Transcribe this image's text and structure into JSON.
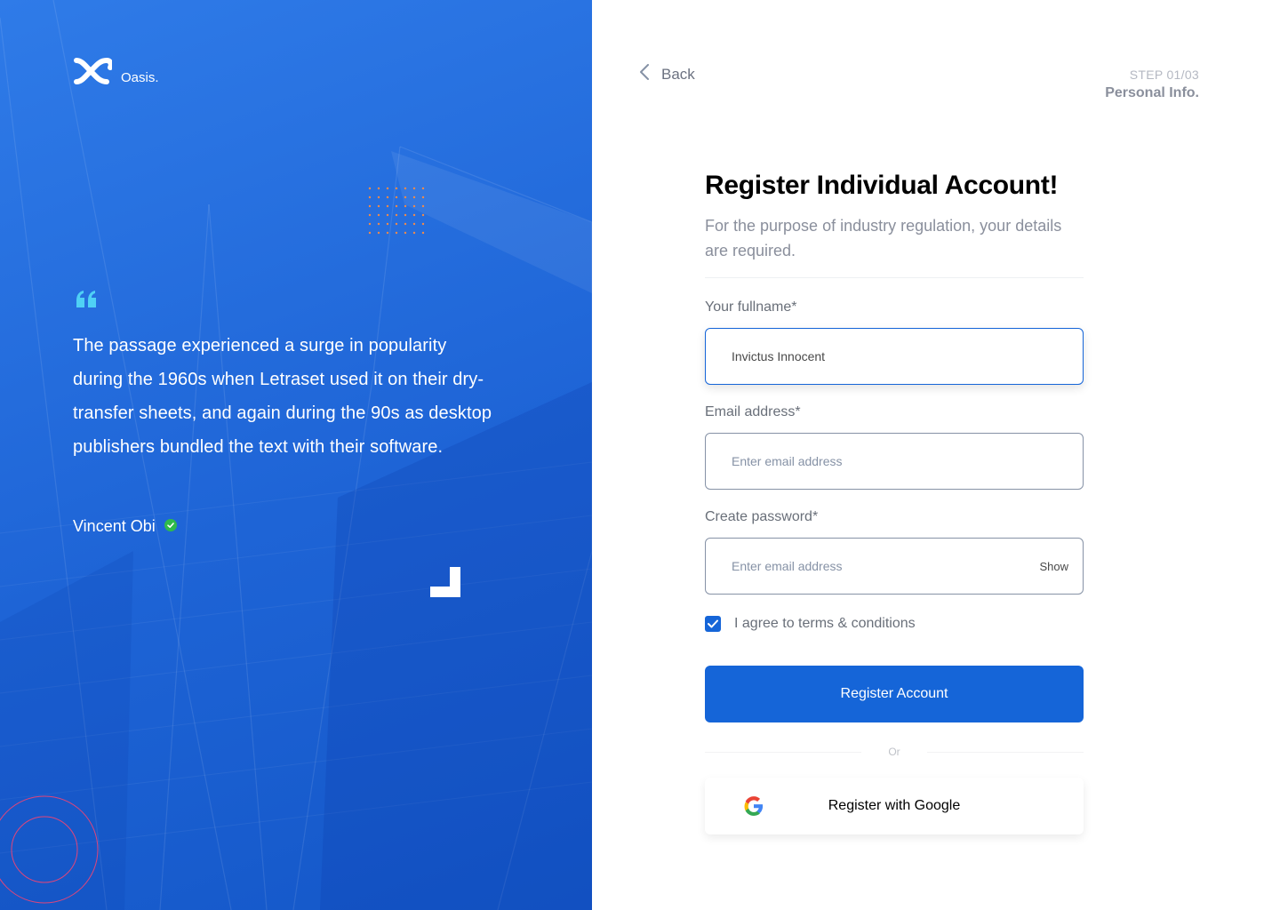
{
  "brand": {
    "name": "Oasis.",
    "logo_icon": "oasis-logo-icon"
  },
  "testimonial": {
    "text": "The passage experienced a surge in popularity during the 1960s when Letraset used it on their dry-transfer sheets, and again during the 90s as desktop publishers bundled the text with their software.",
    "author": "Vincent Obi",
    "verified_icon": "check-circle-icon"
  },
  "nav": {
    "back_label": "Back",
    "back_icon": "chevron-left-icon"
  },
  "step": {
    "number": "STEP 01/03",
    "name": "Personal Info."
  },
  "form": {
    "title": "Register Individual Account!",
    "subtitle": "For the purpose of industry regulation, your details are required.",
    "fullname_label": "Your fullname*",
    "fullname_value": "Invictus Innocent",
    "email_label": "Email address*",
    "email_placeholder": "Enter email address",
    "password_label": "Create password*",
    "password_placeholder": "Enter email address",
    "password_toggle": "Show",
    "terms_label": "I agree to terms & conditions",
    "terms_checked": true,
    "submit_label": "Register Account",
    "or_label": "Or",
    "google_label": "Register with Google"
  },
  "colors": {
    "brand_blue": "#1565d8",
    "panel_blue": "#2f7be8",
    "verified_green": "#2fba4a",
    "quote_cyan": "#4fd1f5"
  }
}
